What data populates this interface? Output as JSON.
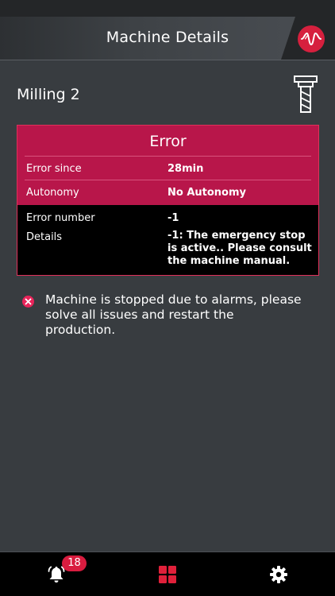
{
  "header": {
    "title": "Machine Details",
    "logo_icon": "waveform-logo-icon",
    "accent": "#d6203e"
  },
  "machine": {
    "name": "Milling 2",
    "icon": "milling-tool-icon"
  },
  "error_card": {
    "title": "Error",
    "rows": [
      {
        "label": "Error since",
        "value": "28min"
      },
      {
        "label": "Autonomy",
        "value": "No Autonomy"
      },
      {
        "label": "Error number",
        "value": "-1"
      },
      {
        "label": "Details",
        "value": "-1: The emergency stop is active.. Please consult the machine manual."
      }
    ],
    "colors": {
      "header_bg": "#b8164a",
      "border": "#e0305a"
    }
  },
  "message": {
    "icon": "error-x-icon",
    "text": "Machine is stopped due to alarms, please solve all issues and restart the production."
  },
  "bottom_nav": {
    "items": [
      {
        "icon": "bell-icon",
        "badge": "18"
      },
      {
        "icon": "grid-icon",
        "active": true
      },
      {
        "icon": "gear-icon"
      }
    ],
    "active_color": "#e0203a"
  }
}
